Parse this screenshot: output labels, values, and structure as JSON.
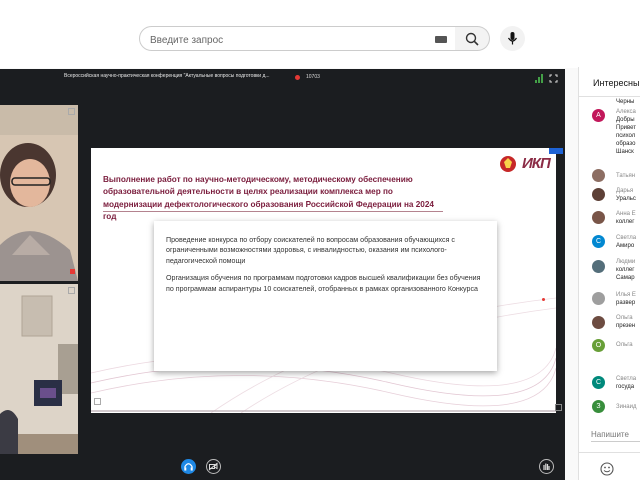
{
  "search": {
    "placeholder": "Введите запрос"
  },
  "player": {
    "conference_title": "Всероссийская научно-практическая конференция \"Актуальные вопросы подготовки д...",
    "timer": "10703"
  },
  "slide": {
    "logo_text": "ИКП",
    "title": "Выполнение работ по научно-методическому, методическому обеспечению образовательной деятельности в целях реализации комплекса мер по модернизации дефектологического образования Российской Федерации на 2024 год",
    "paragraph1": "Проведение конкурса по отбору соискателей  по вопросам образования обучающихся с ограниченными возможностями здоровья, с инвалидностью, оказания им психолого-педагогической помощи",
    "paragraph2": "Организация обучения по программам подготовки кадров высшей квалификации без обучения по программам аспирантуры 10 соискателей, отобранных в рамках организованного Конкурса"
  },
  "chat": {
    "header": "Интересны",
    "input_placeholder": "Напишите",
    "messages": [
      {
        "initial": "",
        "lines": [
          "Черны"
        ],
        "color": "#ffffff"
      },
      {
        "initial": "А",
        "lines": [
          "Алекса",
          "Добры",
          "Привет",
          "психол",
          "образо",
          "Шанск"
        ],
        "color": "#c2185b"
      },
      {
        "initial": "",
        "lines": [
          "Татьян"
        ],
        "color": "#8d6e63"
      },
      {
        "initial": "",
        "lines": [
          "Дарья",
          "Уральс"
        ],
        "color": "#5d4037"
      },
      {
        "initial": "",
        "lines": [
          "Анна Е",
          "коллег"
        ],
        "color": "#795548"
      },
      {
        "initial": "С",
        "lines": [
          "Светла",
          "Амиро"
        ],
        "color": "#0288d1"
      },
      {
        "initial": "",
        "lines": [
          "Людми",
          "коллег",
          "Самар"
        ],
        "color": "#546e7a"
      },
      {
        "initial": "",
        "lines": [
          "Илья Е",
          "развер"
        ],
        "color": "#9e9e9e"
      },
      {
        "initial": "",
        "lines": [
          "Ольга",
          "презен"
        ],
        "color": "#6d4c41"
      },
      {
        "initial": "О",
        "lines": [
          "Ольга"
        ],
        "color": "#689f38"
      },
      {
        "initial": "С",
        "lines": [
          "Светла",
          "госуда"
        ],
        "color": "#00897b"
      },
      {
        "initial": "З",
        "lines": [
          "Зинаид"
        ],
        "color": "#388e3c"
      }
    ]
  },
  "colors": {
    "accent_red": "#e53935",
    "slide_title": "#7a1c3c"
  }
}
